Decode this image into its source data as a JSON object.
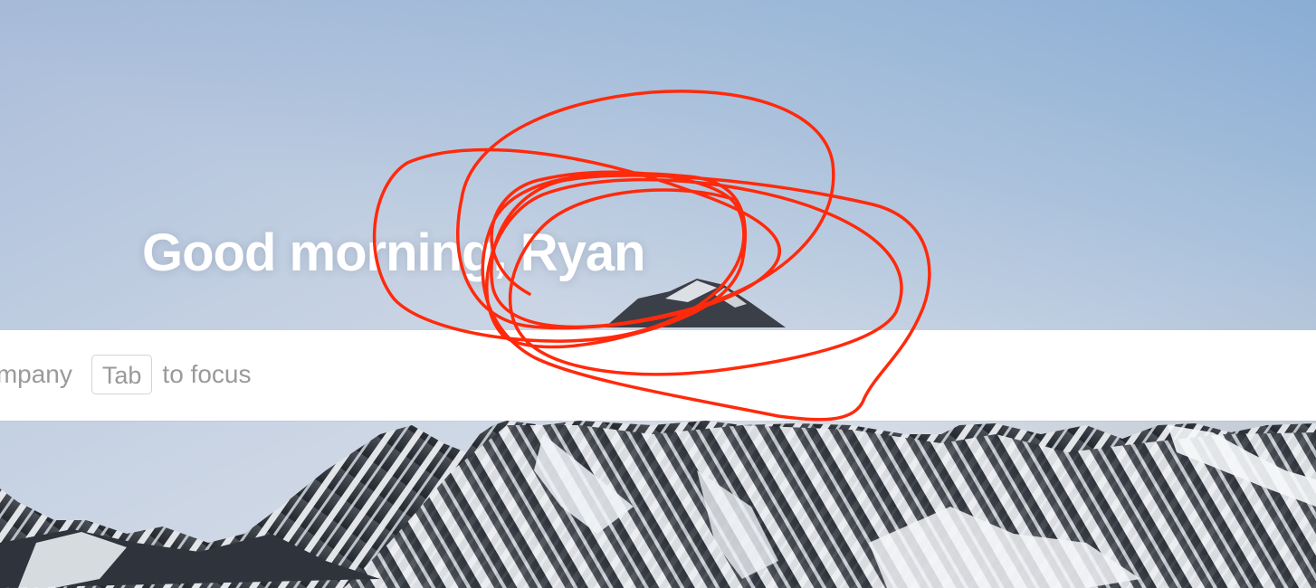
{
  "hero": {
    "greeting": "Good morning, Ryan",
    "sky_top_color": "#7ea6d1",
    "sky_bottom_color": "#dde2ea"
  },
  "search": {
    "placeholder": "your company",
    "shortcut_key": "Tab",
    "shortcut_hint": "to focus"
  },
  "annotation": {
    "type": "freehand-scribble",
    "color": "#ff2a0c"
  }
}
